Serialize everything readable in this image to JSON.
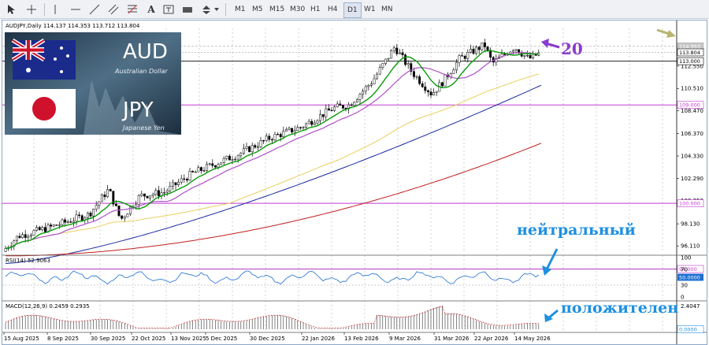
{
  "toolbar": {
    "icons": [
      "cursor-icon",
      "crosshair-icon",
      "vertical-line-icon",
      "horizontal-line-icon",
      "trendline-icon",
      "equidistant-channel-icon",
      "fibonacci-icon",
      "text-icon",
      "text-label-icon",
      "rectangle-icon",
      "arrows-icon",
      "dropdown-icon"
    ],
    "timeframes": [
      "M1",
      "M5",
      "M15",
      "M30",
      "H1",
      "H4",
      "D1",
      "W1",
      "MN"
    ],
    "active_timeframe": "D1"
  },
  "chart": {
    "header": "AUDJPY,Daily  114.137 114.353 113.712 113.804",
    "price_levels": [
      "112.550",
      "110.510",
      "108.470",
      "106.370",
      "104.330",
      "102.290",
      "100.250",
      "98.130",
      "96.110"
    ],
    "highlighted_levels": [
      {
        "label": "114.353",
        "bg": "#c8c8c8",
        "fg": "#ffffff"
      },
      {
        "label": "113.804",
        "bg": "#ffffff",
        "fg": "#000000"
      },
      {
        "label": "113.000",
        "bg": "#ffffff",
        "fg": "#000000"
      },
      {
        "label": "109.000",
        "bg": "#ffffff",
        "fg": "#c23bd0"
      },
      {
        "label": "100.000",
        "bg": "#ffffff",
        "fg": "#c23bd0"
      },
      {
        "label": "94.000",
        "bg": "#ffffff",
        "fg": "#c23bd0"
      }
    ],
    "dates": [
      "15 Aug 2025",
      "8 Sep 2025",
      "30 Sep 2025",
      "22 Oct 2025",
      "13 Nov 2025",
      "5 Dec 2025",
      "30 Dec 2025",
      "22 Jan 2026",
      "13 Feb 2026",
      "9 Mar 2026",
      "31 Mar 2026",
      "22 Apr 2026",
      "14 May 2026"
    ],
    "annotations": {
      "period": "20",
      "rsi_state": "нейтральный",
      "macd_state": "положителен"
    },
    "colors": {
      "annotation": "#1e90e0",
      "purple": "#8b3bd0",
      "magenta": "#c23bd0",
      "candle": "#000000",
      "ma_green": "#0a9a0a",
      "ma_violet": "#b050c8",
      "ma_yellow": "#e8d060",
      "ma_blue": "#1a2aa0",
      "ma_red": "#c02020"
    }
  },
  "logo": {
    "base": "AUD",
    "base_name": "Australian Dollar",
    "quote": "JPY",
    "quote_name": "Japanese Yen"
  },
  "rsi": {
    "label": "RSI(14) 52.9063",
    "levels": [
      "100",
      "70",
      "30",
      "0"
    ],
    "current": "50.0000"
  },
  "macd": {
    "label": "MACD(12,26,9) 0.2459 0.2935",
    "levels": [
      "2.4047",
      "0.0000"
    ]
  }
}
